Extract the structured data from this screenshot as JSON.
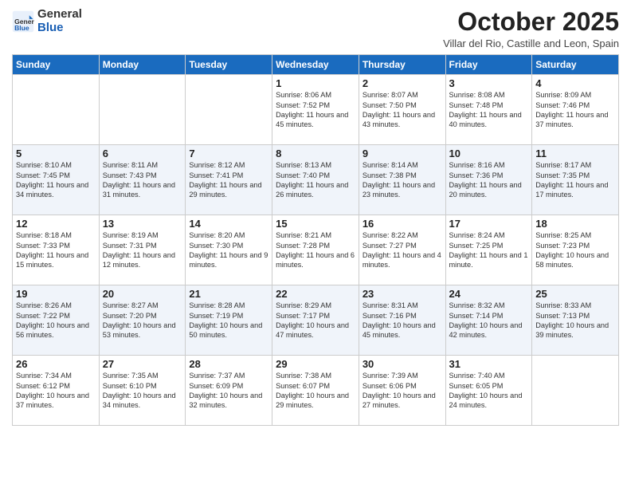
{
  "header": {
    "logo_general": "General",
    "logo_blue": "Blue",
    "month_title": "October 2025",
    "subtitle": "Villar del Rio, Castille and Leon, Spain"
  },
  "days_of_week": [
    "Sunday",
    "Monday",
    "Tuesday",
    "Wednesday",
    "Thursday",
    "Friday",
    "Saturday"
  ],
  "weeks": [
    [
      {
        "day": "",
        "info": ""
      },
      {
        "day": "",
        "info": ""
      },
      {
        "day": "",
        "info": ""
      },
      {
        "day": "1",
        "info": "Sunrise: 8:06 AM\nSunset: 7:52 PM\nDaylight: 11 hours and 45 minutes."
      },
      {
        "day": "2",
        "info": "Sunrise: 8:07 AM\nSunset: 7:50 PM\nDaylight: 11 hours and 43 minutes."
      },
      {
        "day": "3",
        "info": "Sunrise: 8:08 AM\nSunset: 7:48 PM\nDaylight: 11 hours and 40 minutes."
      },
      {
        "day": "4",
        "info": "Sunrise: 8:09 AM\nSunset: 7:46 PM\nDaylight: 11 hours and 37 minutes."
      }
    ],
    [
      {
        "day": "5",
        "info": "Sunrise: 8:10 AM\nSunset: 7:45 PM\nDaylight: 11 hours and 34 minutes."
      },
      {
        "day": "6",
        "info": "Sunrise: 8:11 AM\nSunset: 7:43 PM\nDaylight: 11 hours and 31 minutes."
      },
      {
        "day": "7",
        "info": "Sunrise: 8:12 AM\nSunset: 7:41 PM\nDaylight: 11 hours and 29 minutes."
      },
      {
        "day": "8",
        "info": "Sunrise: 8:13 AM\nSunset: 7:40 PM\nDaylight: 11 hours and 26 minutes."
      },
      {
        "day": "9",
        "info": "Sunrise: 8:14 AM\nSunset: 7:38 PM\nDaylight: 11 hours and 23 minutes."
      },
      {
        "day": "10",
        "info": "Sunrise: 8:16 AM\nSunset: 7:36 PM\nDaylight: 11 hours and 20 minutes."
      },
      {
        "day": "11",
        "info": "Sunrise: 8:17 AM\nSunset: 7:35 PM\nDaylight: 11 hours and 17 minutes."
      }
    ],
    [
      {
        "day": "12",
        "info": "Sunrise: 8:18 AM\nSunset: 7:33 PM\nDaylight: 11 hours and 15 minutes."
      },
      {
        "day": "13",
        "info": "Sunrise: 8:19 AM\nSunset: 7:31 PM\nDaylight: 11 hours and 12 minutes."
      },
      {
        "day": "14",
        "info": "Sunrise: 8:20 AM\nSunset: 7:30 PM\nDaylight: 11 hours and 9 minutes."
      },
      {
        "day": "15",
        "info": "Sunrise: 8:21 AM\nSunset: 7:28 PM\nDaylight: 11 hours and 6 minutes."
      },
      {
        "day": "16",
        "info": "Sunrise: 8:22 AM\nSunset: 7:27 PM\nDaylight: 11 hours and 4 minutes."
      },
      {
        "day": "17",
        "info": "Sunrise: 8:24 AM\nSunset: 7:25 PM\nDaylight: 11 hours and 1 minute."
      },
      {
        "day": "18",
        "info": "Sunrise: 8:25 AM\nSunset: 7:23 PM\nDaylight: 10 hours and 58 minutes."
      }
    ],
    [
      {
        "day": "19",
        "info": "Sunrise: 8:26 AM\nSunset: 7:22 PM\nDaylight: 10 hours and 56 minutes."
      },
      {
        "day": "20",
        "info": "Sunrise: 8:27 AM\nSunset: 7:20 PM\nDaylight: 10 hours and 53 minutes."
      },
      {
        "day": "21",
        "info": "Sunrise: 8:28 AM\nSunset: 7:19 PM\nDaylight: 10 hours and 50 minutes."
      },
      {
        "day": "22",
        "info": "Sunrise: 8:29 AM\nSunset: 7:17 PM\nDaylight: 10 hours and 47 minutes."
      },
      {
        "day": "23",
        "info": "Sunrise: 8:31 AM\nSunset: 7:16 PM\nDaylight: 10 hours and 45 minutes."
      },
      {
        "day": "24",
        "info": "Sunrise: 8:32 AM\nSunset: 7:14 PM\nDaylight: 10 hours and 42 minutes."
      },
      {
        "day": "25",
        "info": "Sunrise: 8:33 AM\nSunset: 7:13 PM\nDaylight: 10 hours and 39 minutes."
      }
    ],
    [
      {
        "day": "26",
        "info": "Sunrise: 7:34 AM\nSunset: 6:12 PM\nDaylight: 10 hours and 37 minutes."
      },
      {
        "day": "27",
        "info": "Sunrise: 7:35 AM\nSunset: 6:10 PM\nDaylight: 10 hours and 34 minutes."
      },
      {
        "day": "28",
        "info": "Sunrise: 7:37 AM\nSunset: 6:09 PM\nDaylight: 10 hours and 32 minutes."
      },
      {
        "day": "29",
        "info": "Sunrise: 7:38 AM\nSunset: 6:07 PM\nDaylight: 10 hours and 29 minutes."
      },
      {
        "day": "30",
        "info": "Sunrise: 7:39 AM\nSunset: 6:06 PM\nDaylight: 10 hours and 27 minutes."
      },
      {
        "day": "31",
        "info": "Sunrise: 7:40 AM\nSunset: 6:05 PM\nDaylight: 10 hours and 24 minutes."
      },
      {
        "day": "",
        "info": ""
      }
    ]
  ]
}
